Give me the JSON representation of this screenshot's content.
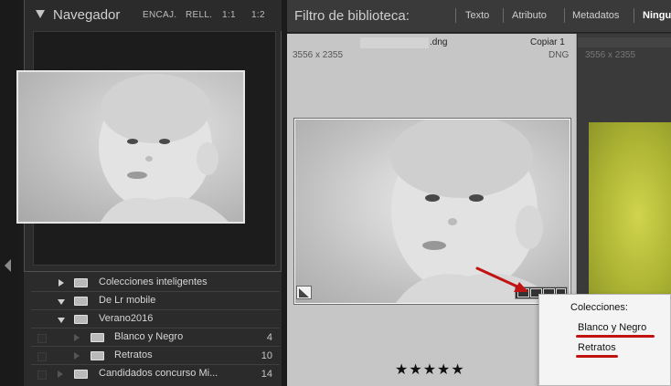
{
  "navigator": {
    "title": "Navegador",
    "options": [
      "ENCAJ.",
      "RELL.",
      "1:1",
      "1:2"
    ]
  },
  "collections": {
    "rows": [
      {
        "label": "Colecciones inteligentes",
        "count": "",
        "state": "collapsed"
      },
      {
        "label": "De Lr mobile",
        "count": "",
        "state": "expanded"
      },
      {
        "label": "Verano2016",
        "count": "",
        "state": "expanded"
      },
      {
        "label": "Blanco y Negro",
        "count": "4",
        "state": "child"
      },
      {
        "label": "Retratos",
        "count": "10",
        "state": "child"
      },
      {
        "label": "Candidados concurso Mi...",
        "count": "14",
        "state": "collapsed"
      }
    ]
  },
  "filter_bar": {
    "title": "Filtro de biblioteca:",
    "options": [
      "Texto",
      "Atributo",
      "Metadatos",
      "Ningu"
    ]
  },
  "grid": {
    "cell1": {
      "filename": ".dng",
      "copy_label": "Copiar 1",
      "dimensions": "3556 x 2355",
      "file_type": "DNG",
      "rating_stars": "★★★★★",
      "rating": 5
    },
    "cell2": {
      "dimensions": "3556 x 2355"
    }
  },
  "popup": {
    "title": "Colecciones:",
    "items": [
      "Blanco y Negro",
      "Retratos"
    ]
  },
  "colors": {
    "accent_red": "#c21313",
    "panel_bg": "#2b2b2b",
    "thumb_bg": "#c6c6c6"
  },
  "icons": [
    "panel-collapse-arrow-icon",
    "disclosure-triangle-icon",
    "collection-folder-icon",
    "virtual-copy-badge-icon",
    "collection-badge-icon",
    "metadata-badge-icon",
    "red-arrow-annotation-icon"
  ]
}
